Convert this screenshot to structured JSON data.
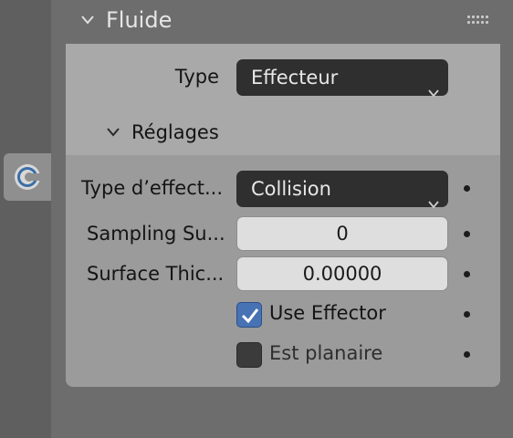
{
  "panel": {
    "title": "Fluide"
  },
  "type_row": {
    "label": "Type",
    "value": "Effecteur"
  },
  "settings": {
    "title": "Réglages",
    "effector_type": {
      "label": "Type d’effect...",
      "value": "Collision"
    },
    "sampling": {
      "label": "Sampling Su...",
      "value": "0"
    },
    "thickness": {
      "label": "Surface Thic...",
      "value": "0.00000"
    },
    "use_effector": {
      "label": "Use Effector",
      "checked": true
    },
    "planar": {
      "label": "Est planaire",
      "checked": false
    }
  },
  "colors": {
    "checkbox_on": "#4772b3",
    "dropdown_bg": "#2f2f2f",
    "accent_icon": "#6fa8dc"
  },
  "icons": [
    "physics-fluid-tab-icon",
    "chevron-down-icon",
    "drag-grip-icon",
    "keyframe-dot-icon",
    "checkmark-icon"
  ]
}
